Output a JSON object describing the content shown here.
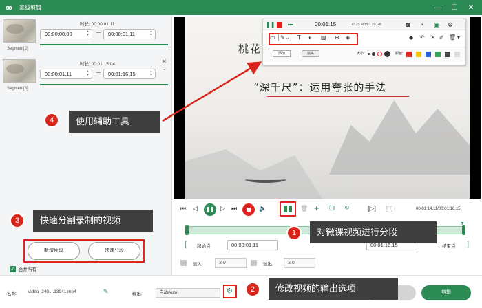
{
  "window": {
    "title": "高级剪辑",
    "app_logo": "ꝏ"
  },
  "segments": [
    {
      "label": "Segment[2]",
      "duration": "时长: 00:00:01.11",
      "start": "00:00:00.00",
      "end": "00:00:01.11"
    },
    {
      "label": "Segment[3]",
      "duration": "时长: 00:01:15.04",
      "start": "00:00:01.11",
      "end": "00:01:16.15"
    }
  ],
  "left_buttons": {
    "new_segment": "新增片段",
    "quick_split": "快速分段"
  },
  "merge_all": "合并所有",
  "slide": {
    "title": "桃花潭",
    "subtitle": "“深千尺”：运用夸张的手法"
  },
  "float_toolbar": {
    "time": "00:01:15",
    "size": "17.25 MB/81.39 GB",
    "tab_add": "添加",
    "tab_shape": "箭头",
    "size_label": "大小:",
    "color_label": "颜色:",
    "swatch_colors": [
      "#e0241f",
      "#f5c400",
      "#2d5fd9",
      "#3aa35a",
      "#444444",
      "#dddddd"
    ]
  },
  "controls": {
    "time_display": "00:01:14.11/00:01:16.15"
  },
  "timeline": {
    "start_label": "起始点",
    "start_time": "00:00:01.11",
    "end_time": "00:01:16.15",
    "end_label": "结束点",
    "fade_in_label": "淡入",
    "fade_in_value": "3.0",
    "fade_out_label": "淡出",
    "fade_out_value": "3.0"
  },
  "bottom": {
    "name_label": "名称:",
    "file_name": "Video_240....13941.mp4",
    "output_label": "输出:",
    "output_value": "自动Auto",
    "export_label": "剪辑"
  },
  "callouts": [
    {
      "num": "1",
      "text": "对微课视频进行分段"
    },
    {
      "num": "2",
      "text": "修改视频的输出选项"
    },
    {
      "num": "3",
      "text": "快速分割录制的视频"
    },
    {
      "num": "4",
      "text": "使用辅助工具"
    }
  ],
  "accent_color": "#2c8a55",
  "highlight_color": "#e0241f"
}
